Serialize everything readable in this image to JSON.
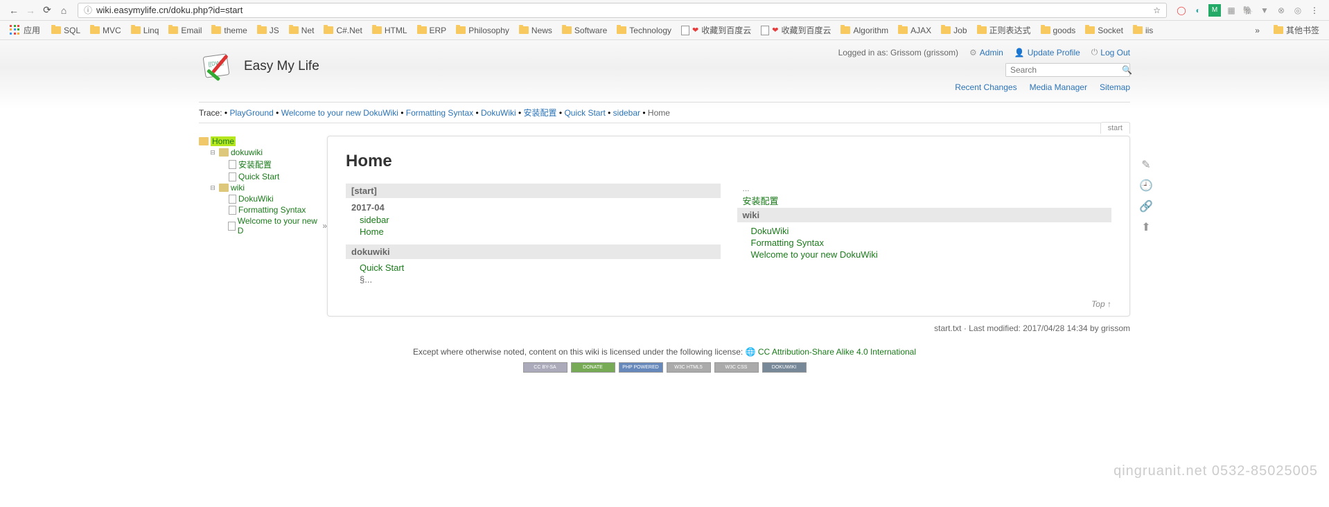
{
  "browser": {
    "url": "wiki.easymylife.cn/doku.php?id=start"
  },
  "bookmarks": {
    "apps": "应用",
    "items": [
      {
        "label": "SQL",
        "type": "folder"
      },
      {
        "label": "MVC",
        "type": "folder"
      },
      {
        "label": "Linq",
        "type": "folder"
      },
      {
        "label": "Email",
        "type": "folder"
      },
      {
        "label": "theme",
        "type": "folder"
      },
      {
        "label": "JS",
        "type": "folder"
      },
      {
        "label": "Net",
        "type": "folder"
      },
      {
        "label": "C#.Net",
        "type": "folder"
      },
      {
        "label": "HTML",
        "type": "folder"
      },
      {
        "label": "ERP",
        "type": "folder"
      },
      {
        "label": "Philosophy",
        "type": "folder"
      },
      {
        "label": "News",
        "type": "folder"
      },
      {
        "label": "Software",
        "type": "folder"
      },
      {
        "label": "Technology",
        "type": "folder"
      },
      {
        "label": "收藏到百度云",
        "type": "heart"
      },
      {
        "label": "收藏到百度云",
        "type": "heart"
      },
      {
        "label": "Algorithm",
        "type": "folder"
      },
      {
        "label": "AJAX",
        "type": "folder"
      },
      {
        "label": "Job",
        "type": "folder"
      },
      {
        "label": "正则表达式",
        "type": "folder"
      },
      {
        "label": "goods",
        "type": "folder"
      },
      {
        "label": "Socket",
        "type": "folder"
      },
      {
        "label": "iis",
        "type": "folder"
      }
    ],
    "overflow": "»",
    "other": "其他书签"
  },
  "site": {
    "title": "Easy My Life",
    "login_text": "Logged in as: Grissom (grissom)",
    "admin": "Admin",
    "update": "Update Profile",
    "logout": "Log Out",
    "search_placeholder": "Search",
    "recent": "Recent Changes",
    "media": "Media Manager",
    "sitemap": "Sitemap"
  },
  "trace": {
    "label": "Trace:",
    "items": [
      "PlayGround",
      "Welcome to your new DokuWiki",
      "Formatting Syntax",
      "DokuWiki",
      "安装配置",
      "Quick Start",
      "sidebar"
    ],
    "current": "Home"
  },
  "tree": {
    "home": "Home",
    "nodes": [
      {
        "label": "dokuwiki",
        "type": "ns",
        "children": [
          {
            "label": "安装配置",
            "type": "page"
          },
          {
            "label": "Quick Start",
            "type": "page"
          }
        ]
      },
      {
        "label": "wiki",
        "type": "ns",
        "children": [
          {
            "label": "DokuWiki",
            "type": "page"
          },
          {
            "label": "Formatting Syntax",
            "type": "page"
          },
          {
            "label": "Welcome to your new D",
            "type": "page",
            "trunc": "»"
          }
        ]
      }
    ]
  },
  "page": {
    "tab": "start",
    "h1": "Home",
    "left": {
      "s1": {
        "header": "[start]",
        "sub": "2017-04",
        "links": [
          "sidebar",
          "Home"
        ]
      },
      "s2": {
        "header": "dokuwiki",
        "links": [
          "Quick Start"
        ],
        "trail": "§..."
      }
    },
    "right": {
      "ellipsis": "...",
      "top_link": "安装配置",
      "s1": {
        "header": "wiki",
        "links": [
          "DokuWiki",
          "Formatting Syntax",
          "Welcome to your new DokuWiki"
        ]
      }
    },
    "top_link": "Top ↑"
  },
  "meta": "start.txt · Last modified: 2017/04/28 14:34 by grissom",
  "license": {
    "text": "Except where otherwise noted, content on this wiki is licensed under the following license: ",
    "link": "CC Attribution-Share Alike 4.0 International"
  },
  "watermark": "qingruanit.net 0532-85025005"
}
